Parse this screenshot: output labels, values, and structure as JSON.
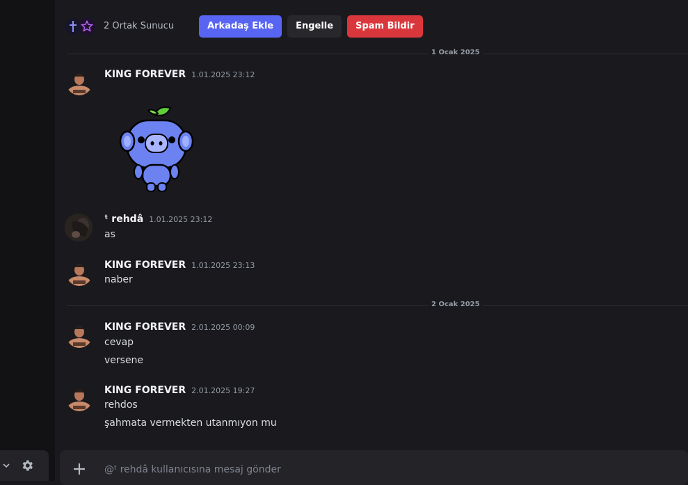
{
  "profile_bar": {
    "mutual_servers": "2 Ortak Sunucu",
    "add_friend": "Arkadaş Ekle",
    "block": "Engelle",
    "report_spam": "Spam Bildir"
  },
  "dates": [
    "1 Ocak 2025",
    "2 Ocak 2025"
  ],
  "messages": [
    {
      "user": "KING FOREVER",
      "time": "1.01.2025 23:12",
      "lines": []
    },
    {
      "user": "ᵗ rehdâ",
      "time": "1.01.2025 23:12",
      "lines": [
        "as"
      ]
    },
    {
      "user": "KING FOREVER",
      "time": "1.01.2025 23:13",
      "lines": [
        "naber"
      ]
    },
    {
      "user": "KING FOREVER",
      "time": "2.01.2025 00:09",
      "lines": [
        "cevap",
        "versene"
      ]
    },
    {
      "user": "KING FOREVER",
      "time": "2.01.2025 19:27",
      "lines": [
        "rehdos",
        "şahmata vermekten utanmıyon mu"
      ]
    }
  ],
  "composer": {
    "placeholder": "@ᵗ rehdâ kullanıcısına mesaj gönder"
  },
  "icons": {
    "rail_chevron": "chevron-down-icon",
    "rail_settings": "gear-icon",
    "composer_add": "plus-icon",
    "sticker": "wumpus-sticker"
  },
  "colors": {
    "primary": "#5865f2",
    "danger": "#da373c",
    "background": "#1a1a1e"
  }
}
